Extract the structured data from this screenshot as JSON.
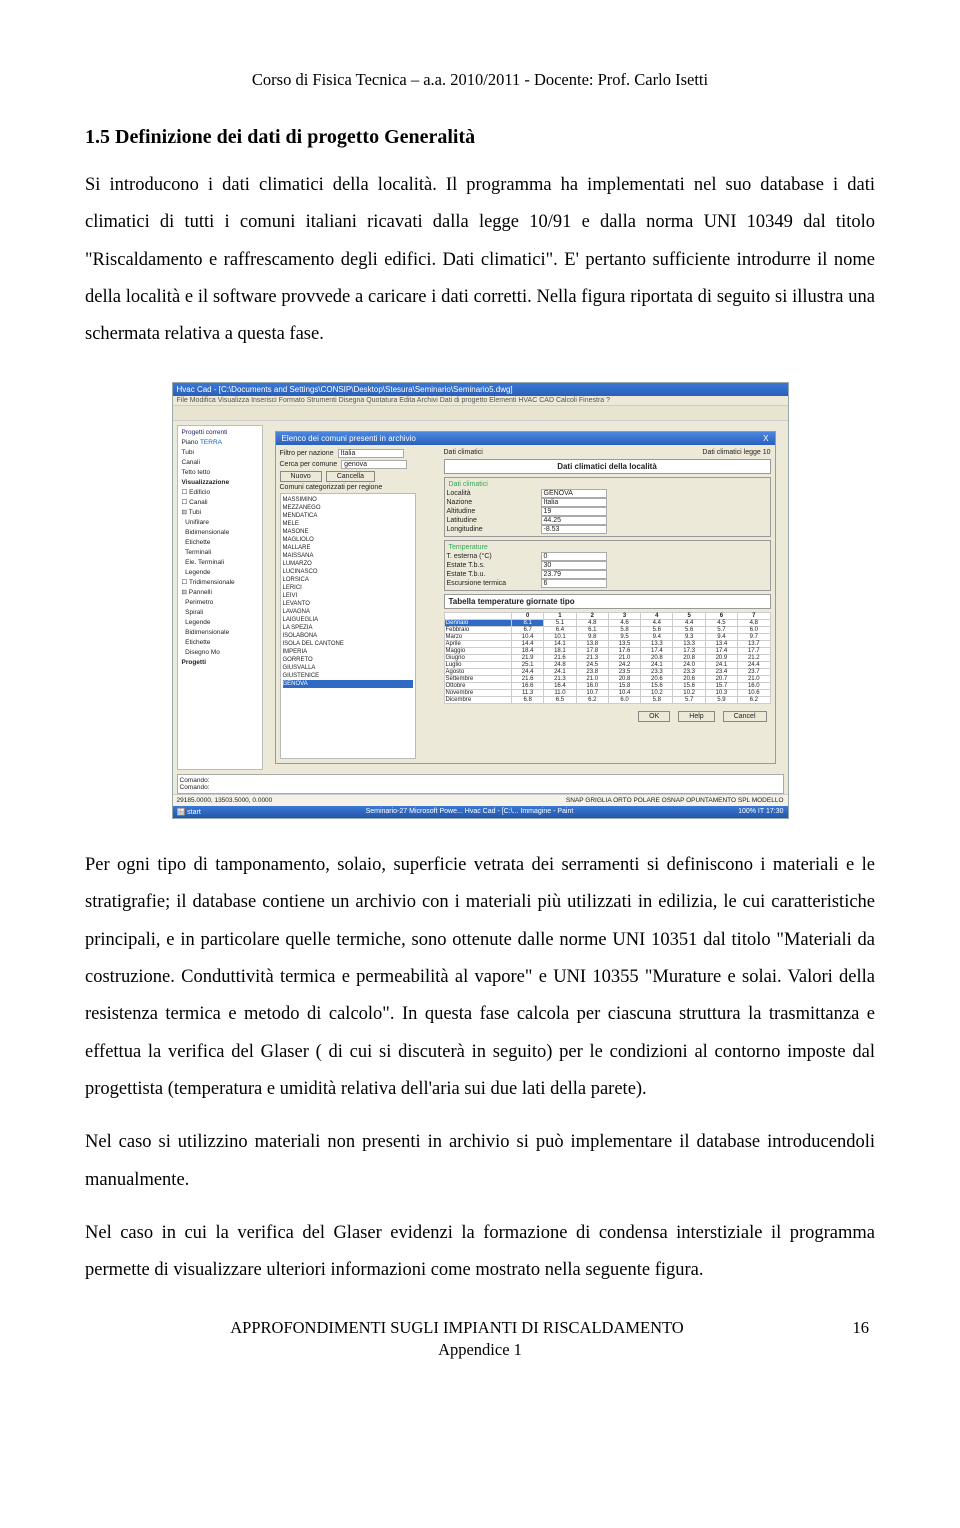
{
  "header": "Corso di Fisica Tecnica – a.a. 2010/2011 - Docente: Prof. Carlo Isetti",
  "section_title": "1.5 Definizione dei dati di progetto Generalità",
  "para1": "Si introducono i dati climatici della località. Il programma ha implementati nel suo database i dati climatici di tutti i comuni italiani ricavati dalla legge 10/91 e dalla norma UNI 10349 dal titolo \"Riscaldamento e raffrescamento degli edifici. Dati climatici\". E' pertanto sufficiente introdurre il nome della località e il software provvede a caricare i dati corretti. Nella figura riportata di seguito si illustra una schermata relativa a questa fase.",
  "para2": "Per ogni tipo di tamponamento, solaio, superficie vetrata dei serramenti si definiscono i materiali e le stratigrafie; il database contiene un archivio con i materiali più utilizzati in edilizia, le cui caratteristiche principali, e in particolare quelle termiche, sono ottenute dalle norme UNI 10351 dal titolo \"Materiali da costruzione. Conduttività termica e permeabilità al vapore\" e UNI 10355 \"Murature e solai. Valori della resistenza termica e metodo di calcolo\". In questa fase calcola per ciascuna struttura la trasmittanza e effettua la verifica del Glaser ( di cui si discuterà in seguito) per le condizioni al contorno imposte dal progettista (temperatura e umidità relativa dell'aria sui due lati della parete).",
  "para3": "Nel caso si utilizzino materiali non presenti in archivio si può implementare il database introducendoli manualmente.",
  "para4": "Nel caso in cui la verifica del Glaser evidenzi la formazione di condensa interstiziale il programma permette di visualizzare ulteriori informazioni come mostrato nella seguente figura.",
  "footer_title": "APPROFONDIMENTI SUGLI IMPIANTI DI RISCALDAMENTO",
  "footer_sub": "Appendice 1",
  "page_num": "16",
  "screenshot": {
    "window_title": "Hvac Cad - [C:\\Documents and Settings\\CONSIP\\Desktop\\Stesura\\Seminario\\Seminario5.dwg]",
    "menu": "File  Modifica  Visualizza  Inserisci  Formato  Strumenti  Disegna  Quotatura  Edita  Archivi  Dati di progetto  Elementi HVAC CAD  Calcoli  Finestra  ?",
    "dialog_title": "Elenco dei comuni presenti in archivio",
    "dialog_close": "X",
    "left_tree": {
      "piano_lbl": "Piano",
      "piano_val": "TERRA",
      "tubi": "Tubi",
      "canali": "Canali",
      "tetto_lbl": "Tetto",
      "tetto_val": "tetto",
      "vis": "Visualizzazione",
      "edificio": "Edificio",
      "canali2": "Canali",
      "tubi_group": "Tubi",
      "unifilare": "Unifilare",
      "bidim": "Bidimensionale",
      "etic": "Etichette",
      "term": "Terminali",
      "eleterm": "Ele. Terminali",
      "legende": "Legende",
      "trid": "Tridimensionale",
      "pannelli": "Pannelli",
      "perimetro": "Perimetro",
      "spirali": "Spirali",
      "legende2": "Legende",
      "bidim2": "Bidimensionale",
      "etic2": "Etichette",
      "disegno": "Disegno Mo",
      "progetti": "Progetti",
      "progetti_corr": "Progetti correnti"
    },
    "filter_nation_lbl": "Filtro per nazione",
    "filter_nation_val": "Italia",
    "dati_clim_hdr": "Dati climatici",
    "dati_legge10": "Dati climatici legge 10",
    "search_lbl": "Cerca per comune",
    "search_val": "genova",
    "heading": "Dati climatici della località",
    "btn_nuovo": "Nuovo",
    "btn_cancella": "Cancella",
    "comuni_caption": "Comuni categorizzati per regione",
    "comuni": [
      "MASSIMINO",
      "MEZZANEGO",
      "MENDATICA",
      "MELE",
      "MASONE",
      "MAGLIOLO",
      "MALLARE",
      "MAISSANA",
      "LUMARZO",
      "LUCINASCO",
      "LORSICA",
      "LERICI",
      "LEIVI",
      "LEVANTO",
      "LAVAGNA",
      "LAIGUEGLIA",
      "LA SPEZIA",
      "ISOLABONA",
      "ISOLA DEL CANTONE",
      "IMPERIA",
      "GORRETO",
      "GIUSVALLA",
      "GIUSTENICE",
      "GENOVA"
    ],
    "group_dati": "Dati climatici",
    "loc_lbl": "Località",
    "loc_val": "GENOVA",
    "naz_lbl": "Nazione",
    "naz_val": "Italia",
    "alt_lbl": "Altitudine",
    "alt_val": "19",
    "lat_lbl": "Latitudine",
    "lat_val": "44.25",
    "lon_lbl": "Longitudine",
    "lon_val": "-8.53",
    "group_temp": "Temperature",
    "text_lbl": "T. esterna (°C)",
    "text_val": "0",
    "tbs_lbl": "Estate T.b.s.",
    "tbs_val": "30",
    "tbu_lbl": "Estate T.b.u.",
    "tbu_val": "23.79",
    "esc_lbl": "Escursione termica",
    "esc_val": "6",
    "tab_title": "Tabella temperature giornate tipo",
    "months": [
      "Gennaio",
      "Febbraio",
      "Marzo",
      "Aprile",
      "Maggio",
      "Giugno",
      "Luglio",
      "Agosto",
      "Settembre",
      "Ottobre",
      "Novembre",
      "Dicembre"
    ],
    "cols": [
      "0",
      "1",
      "2",
      "3",
      "4",
      "5",
      "6",
      "7"
    ],
    "table_rows": [
      [
        "8.1",
        "5.1",
        "4.8",
        "4.6",
        "4.4",
        "4.4",
        "4.5",
        "4.8"
      ],
      [
        "6.7",
        "6.4",
        "6.1",
        "5.8",
        "5.6",
        "5.6",
        "5.7",
        "6.0"
      ],
      [
        "10.4",
        "10.1",
        "9.8",
        "9.5",
        "9.4",
        "9.3",
        "9.4",
        "9.7"
      ],
      [
        "14.4",
        "14.1",
        "13.8",
        "13.5",
        "13.3",
        "13.3",
        "13.4",
        "13.7"
      ],
      [
        "18.4",
        "18.1",
        "17.8",
        "17.6",
        "17.4",
        "17.3",
        "17.4",
        "17.7"
      ],
      [
        "21.9",
        "21.6",
        "21.3",
        "21.0",
        "20.8",
        "20.8",
        "20.9",
        "21.2"
      ],
      [
        "25.1",
        "24.8",
        "24.5",
        "24.2",
        "24.1",
        "24.0",
        "24.1",
        "24.4"
      ],
      [
        "24.4",
        "24.1",
        "23.8",
        "23.5",
        "23.3",
        "23.3",
        "23.4",
        "23.7"
      ],
      [
        "21.6",
        "21.3",
        "21.0",
        "20.8",
        "20.6",
        "20.6",
        "20.7",
        "21.0"
      ],
      [
        "16.6",
        "16.4",
        "16.0",
        "15.8",
        "15.6",
        "15.6",
        "15.7",
        "16.0"
      ],
      [
        "11.3",
        "11.0",
        "10.7",
        "10.4",
        "10.2",
        "10.2",
        "10.3",
        "10.6"
      ],
      [
        "6.8",
        "6.5",
        "6.2",
        "6.0",
        "5.8",
        "5.7",
        "5.9",
        "6.2"
      ]
    ],
    "btn_ok": "OK",
    "btn_help": "Help",
    "btn_cancel": "Cancel",
    "status_left": "Comando:\nComando:",
    "status_coords": "29185.0000, 13503.5000, 0.0000",
    "status_mid": "SNAP  GRIGLIA  ORTO  POLARE  OSNAP  OPUNTAMENTO  SPL  MODELLO",
    "taskbar_start": "start",
    "taskbar_items": "Seminario-27    Microsoft Powe...    Hvac Cad - [C:\\...    Immagine - Paint",
    "taskbar_right": "100%   IT   17:30"
  }
}
